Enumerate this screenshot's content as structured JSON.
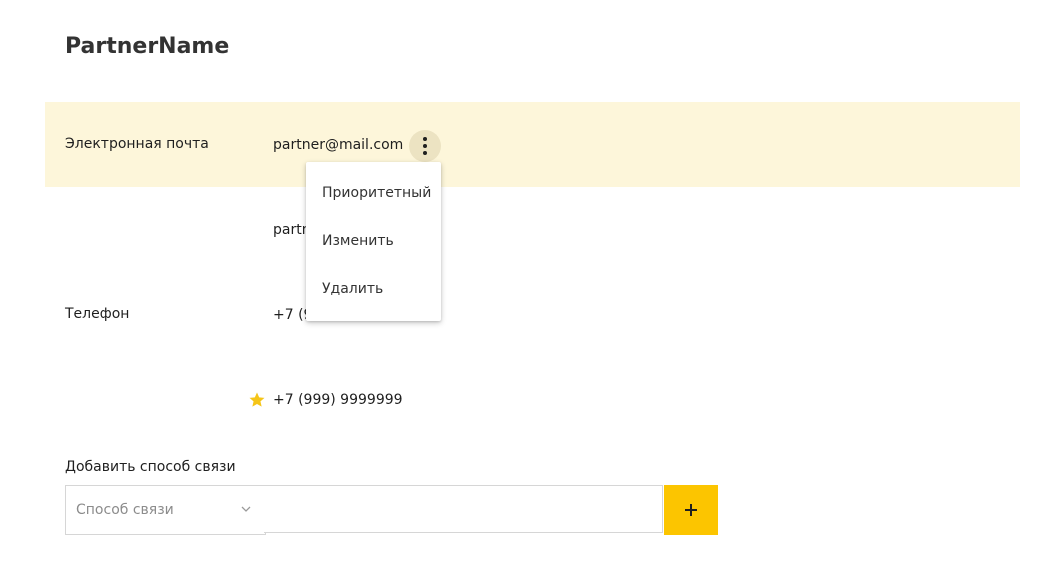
{
  "page": {
    "title": "PartnerName"
  },
  "contacts": {
    "email_label": "Электронная почта",
    "emails": [
      "partner@mail.com",
      "partner@mail.com"
    ],
    "phone_label": "Телефон",
    "phones": [
      "+7 (999) 9999999",
      "+7 (999) 9999999"
    ]
  },
  "context_menu": {
    "items": [
      "Приоритетный",
      "Изменить",
      "Удалить"
    ]
  },
  "add_contact": {
    "label": "Добавить способ связи",
    "select_placeholder": "Способ связи",
    "input_value": "",
    "add_button_label": "+"
  },
  "colors": {
    "highlight": "#fdf6da",
    "accent": "#fcc500",
    "kebab_bg": "#ece3c2"
  },
  "icons": {
    "kebab": "more-vertical-icon",
    "priority": "star-icon",
    "select": "chevron-down-icon"
  }
}
